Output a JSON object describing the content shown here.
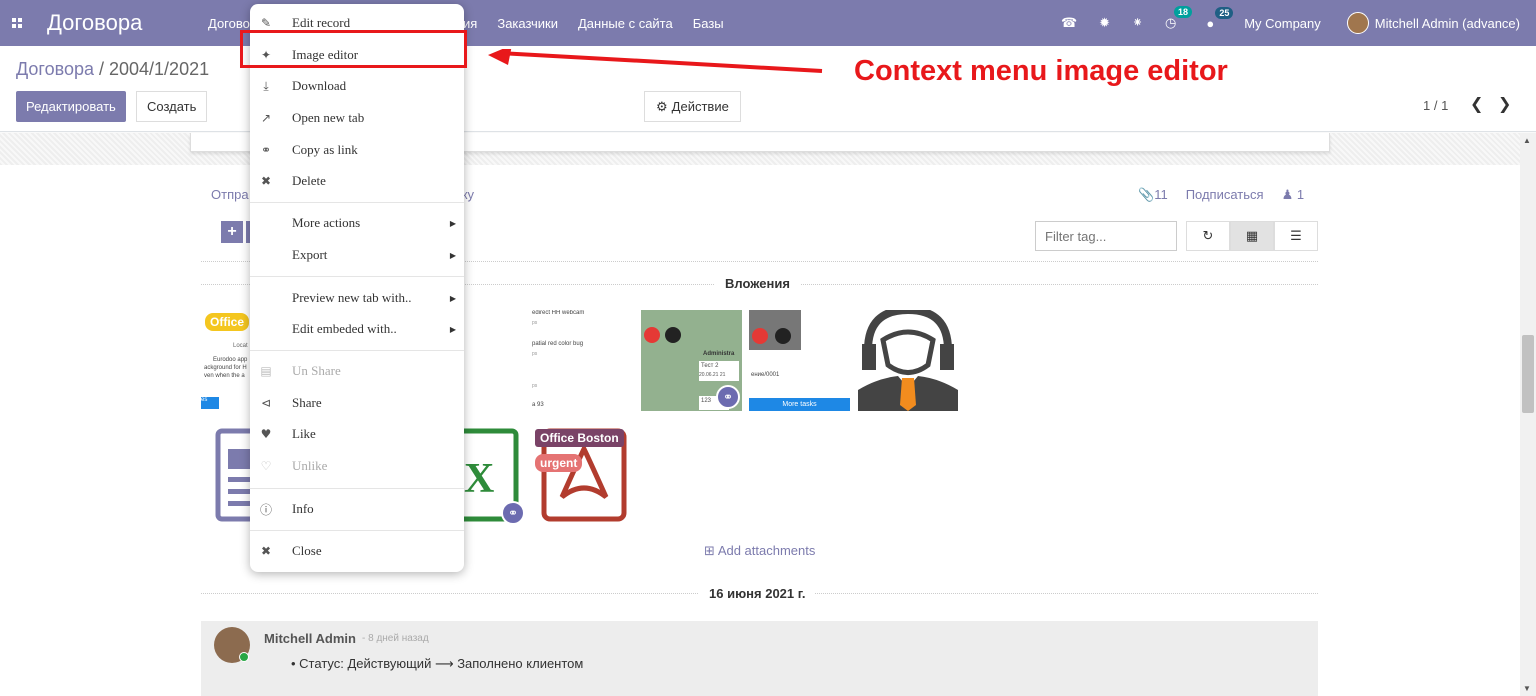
{
  "navbar": {
    "brand": "Договора",
    "menu": [
      "Догово",
      "ния",
      "Заказчики",
      "Данные с сайта",
      "Базы"
    ],
    "badges": {
      "activities": "18",
      "messages": "25"
    },
    "company": "My Company",
    "user": "Mitchell Admin (advance)"
  },
  "control": {
    "breadcrumb_parent": "Договора",
    "breadcrumb_sep": " / ",
    "breadcrumb_current": "2004/1/2021",
    "edit_label": "Редактировать",
    "create_label": "Создать",
    "action_label": "Действие",
    "pager": "1 / 1"
  },
  "chatter": {
    "send_label": "Отпра",
    "note_label": "метку",
    "attachments_count": "11",
    "follow_label": "Подписаться",
    "followers_count": "1",
    "filter_placeholder": "Filter tag...",
    "attachments_title": "Вложения",
    "add_attachments": "Add attachments",
    "date_separator": "16 июня 2021 г.",
    "message": {
      "author": "Mitchell Admin",
      "date": "- 8 дней назад",
      "body": "Статус: Действующий ⟶ Заполнено клиентом"
    }
  },
  "tags": {
    "office": "Office",
    "office_boston": "Office Boston",
    "urgent": "urgent"
  },
  "thumb_text": {
    "t1_a": "Locat",
    "t1_b": "Eurodoo app",
    "t1_c": "ackground for H",
    "t1_d": "ven when the a",
    "t1_e": "es",
    "t2_a": "edirect HH webcam",
    "t2_b": "ps",
    "t2_c": "patial red color bug",
    "t2_d": "ps",
    "t2_e": "ps",
    "t2_f": "а 93",
    "t3_a": "Administra",
    "t3_b": "Тест 2",
    "t3_c": "20.06.21 21",
    "t3_d": "123",
    "t4_a": "ение/0001",
    "t4_b": "More tasks",
    "xlsx_letter": "X"
  },
  "context_menu": {
    "items": [
      {
        "label": "Edit record",
        "icon": "pencil-square-icon"
      },
      {
        "label": "Image editor",
        "icon": "magic-wand-icon"
      },
      {
        "label": "Download",
        "icon": "download-icon"
      },
      {
        "label": "Open new tab",
        "icon": "external-link-icon"
      },
      {
        "label": "Copy as link",
        "icon": "link-icon"
      },
      {
        "label": "Delete",
        "icon": "close-icon"
      },
      {
        "label": "More actions",
        "icon": ""
      },
      {
        "label": "Export",
        "icon": ""
      },
      {
        "label": "Preview new tab with..",
        "icon": ""
      },
      {
        "label": "Edit embeded with..",
        "icon": ""
      },
      {
        "label": "Un Share",
        "icon": "share-square-icon"
      },
      {
        "label": "Share",
        "icon": "share-icon"
      },
      {
        "label": "Like",
        "icon": "heart-icon"
      },
      {
        "label": "Unlike",
        "icon": "heart-outline-icon"
      },
      {
        "label": "Info",
        "icon": "info-icon"
      },
      {
        "label": "Close",
        "icon": "close-icon"
      }
    ]
  },
  "annotation": {
    "text": "Context menu image editor",
    "color": "#e8181b"
  },
  "colors": {
    "brand": "#7c7bad",
    "tag_office": "#f4c61f",
    "tag_office_boston": "#7a4367",
    "tag_urgent": "#e57373"
  }
}
